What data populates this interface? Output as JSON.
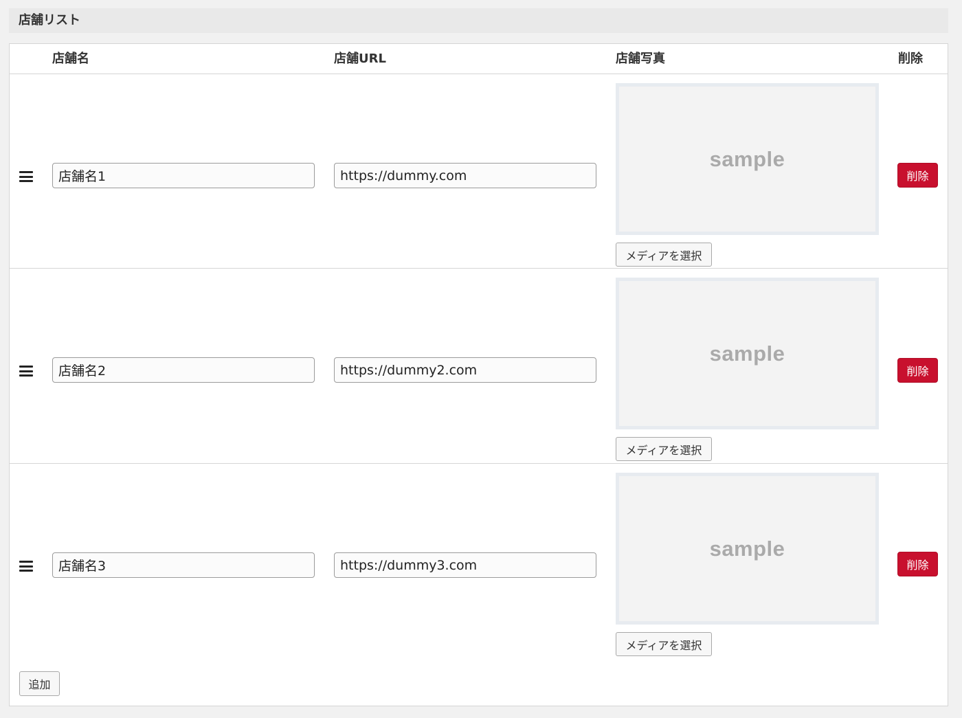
{
  "section": {
    "title": "店舗リスト"
  },
  "columns": {
    "name": "店舗名",
    "url": "店舗URL",
    "photo": "店舗写真",
    "delete": "削除"
  },
  "rows": [
    {
      "name": "店舗名1",
      "url": "https://dummy.com",
      "photo_text": "sample",
      "media_label": "メディアを選択",
      "delete_label": "削除"
    },
    {
      "name": "店舗名2",
      "url": "https://dummy2.com",
      "photo_text": "sample",
      "media_label": "メディアを選択",
      "delete_label": "削除"
    },
    {
      "name": "店舗名3",
      "url": "https://dummy3.com",
      "photo_text": "sample",
      "media_label": "メディアを選択",
      "delete_label": "削除"
    }
  ],
  "add_label": "追加",
  "icons": {
    "drag_handle": "drag-handle-icon"
  },
  "colors": {
    "delete_button": "#c8102e",
    "background": "#f1f1f1"
  }
}
